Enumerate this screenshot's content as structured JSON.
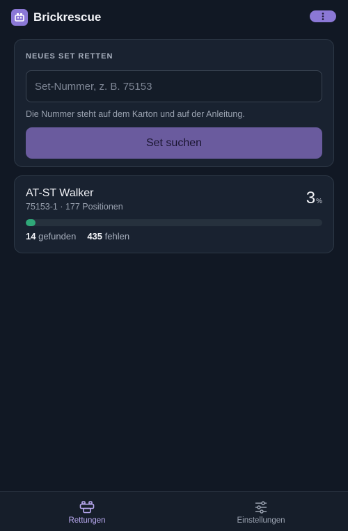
{
  "header": {
    "title": "Brickrescue",
    "logo_icon": "brick-icon",
    "menu_icon": "kebab-menu-icon"
  },
  "new_set": {
    "section_label": "NEUES SET RETTEN",
    "input_placeholder": "Set-Nummer, z. B. 75153",
    "input_value": "",
    "hint": "Die Nummer steht auf dem Karton und auf der Anleitung.",
    "search_button_label": "Set suchen"
  },
  "sets": [
    {
      "name": "AT-ST Walker",
      "meta": "75153-1 · 177 Positionen",
      "percent": "3",
      "percent_sign": "%",
      "progress_fraction": 0.03,
      "found_count": "14",
      "found_label": "gefunden",
      "missing_count": "435",
      "missing_label": "fehlen"
    }
  ],
  "nav": {
    "items": [
      {
        "label": "Rettungen",
        "icon": "brick-icon",
        "active": true
      },
      {
        "label": "Einstellungen",
        "icon": "sliders-icon",
        "active": false
      }
    ]
  },
  "colors": {
    "accent": "#8b78d6",
    "progress": "#2fa878",
    "background": "#111824"
  }
}
